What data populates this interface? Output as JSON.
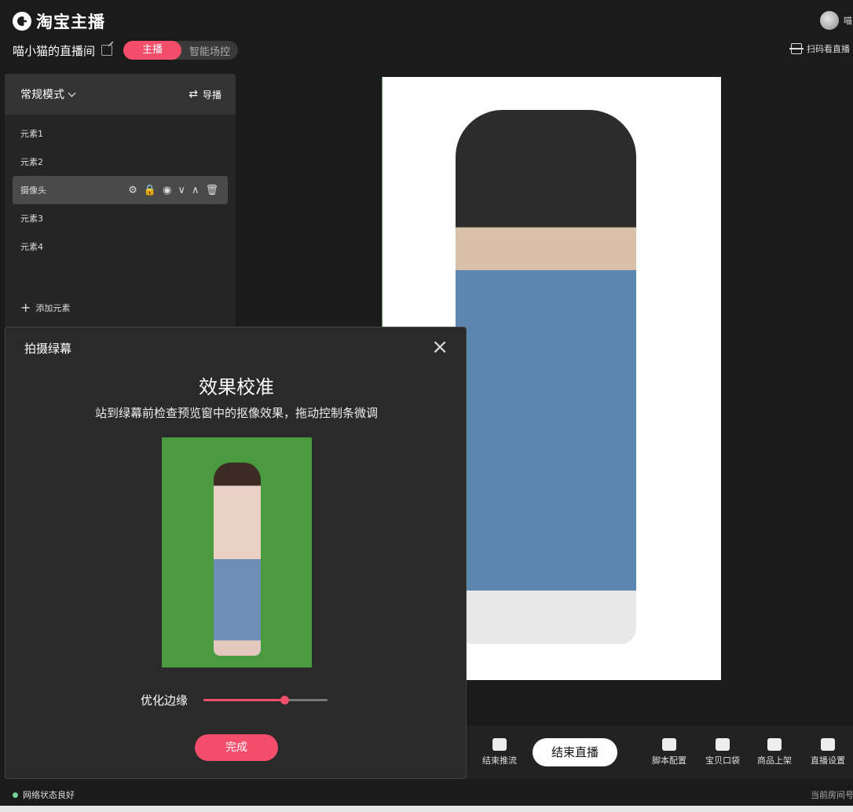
{
  "app": {
    "logo_text": "淘宝主播",
    "user_name": "喵"
  },
  "room": {
    "title": "喵小猫的直播间",
    "roles": [
      "主播",
      "智能场控"
    ],
    "scan_label": "扫码看直播"
  },
  "left_panel": {
    "mode": "常规模式",
    "guide_label": "导播",
    "elements": [
      "元素1",
      "元素2",
      "摄像头",
      "元素3",
      "元素4"
    ],
    "active_index": 2,
    "active_tools": [
      "⚙",
      "🔒",
      "◉",
      "∨",
      "∧",
      "🗑"
    ],
    "add_label": "添加元素"
  },
  "modal": {
    "title": "拍摄绿幕",
    "close_icon": "×",
    "heading": "效果校准",
    "subtitle": "站到绿幕前检查预览窗中的抠像效果，拖动控制条微调",
    "slider_label": "优化边缘",
    "slider_value": 0.65,
    "done_label": "完成"
  },
  "toolbar": {
    "push_label": "结束推流",
    "end_live_label": "结束直播",
    "script_label": "脚本配置",
    "pocket_label": "宝贝口袋",
    "shelf_label": "商品上架",
    "settings_label": "直播设置"
  },
  "status": {
    "network": "网络状态良好",
    "room_id": "当前房间号"
  },
  "colors": {
    "accent": "#f24d6b",
    "green_screen": "#4a9a3f",
    "status_ok": "#6fd39b"
  }
}
